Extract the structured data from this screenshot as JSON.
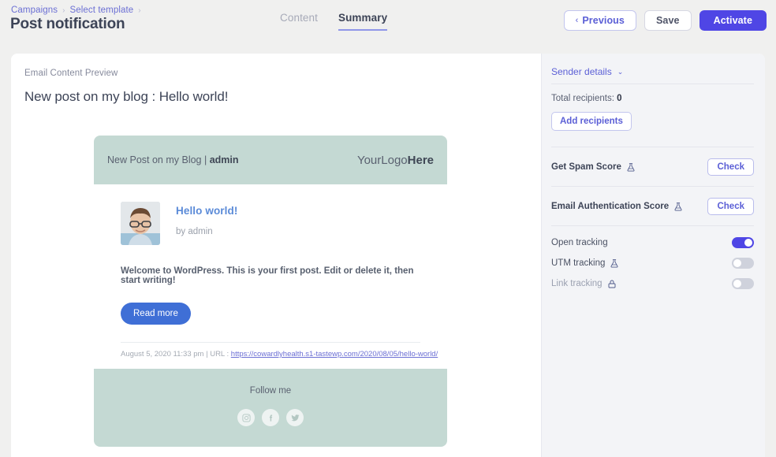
{
  "header": {
    "breadcrumb": [
      "Campaigns",
      "Select template"
    ],
    "breadcrumb_separator": "›",
    "title": "Post notification",
    "tabs": [
      {
        "label": "Content",
        "active": false
      },
      {
        "label": "Summary",
        "active": true
      }
    ],
    "actions": {
      "previous": "Previous",
      "previous_chevron": "‹",
      "save": "Save",
      "activate": "Activate"
    }
  },
  "preview": {
    "label": "Email Content Preview",
    "subject": "New post on my blog : Hello world!",
    "email": {
      "head_title": "New Post on my Blog | ",
      "head_author": "admin",
      "logo_light": "YourLogo",
      "logo_bold": "Here",
      "post_title": "Hello world!",
      "post_by": "by admin",
      "post_excerpt": "Welcome to WordPress. This is your first post. Edit or delete it, then start writing!",
      "read_more": "Read more",
      "footer_date": "August 5, 2020 11:33 pm | URL : ",
      "footer_url": "https://cowardlyhealth.s1-tastewp.com/2020/08/05/hello-world/",
      "follow_me": "Follow me",
      "socials": [
        "instagram-icon",
        "facebook-icon",
        "twitter-icon"
      ]
    }
  },
  "sidebar": {
    "sender_details": "Sender details",
    "chevron": "⌄",
    "total_recipients_label": "Total recipients: ",
    "total_recipients_value": "0",
    "add_recipients": "Add recipients",
    "scores": [
      {
        "label": "Get Spam Score",
        "icon": "flask-icon",
        "button": "Check"
      },
      {
        "label": "Email Authentication Score",
        "icon": "flask-icon",
        "button": "Check"
      }
    ],
    "tracking": [
      {
        "label": "Open tracking",
        "icon": null,
        "on": true,
        "locked": false
      },
      {
        "label": "UTM tracking",
        "icon": "flask-icon",
        "on": false,
        "locked": false
      },
      {
        "label": "Link tracking",
        "icon": "lock-icon",
        "on": false,
        "locked": true
      }
    ]
  },
  "colors": {
    "accent": "#4f46e5",
    "link": "#6b6fd4",
    "email_band": "#c4d9d3",
    "read_more": "#3f6fd6",
    "page_bg": "#f0f0ef",
    "panel_bg": "#f3f4f7"
  }
}
